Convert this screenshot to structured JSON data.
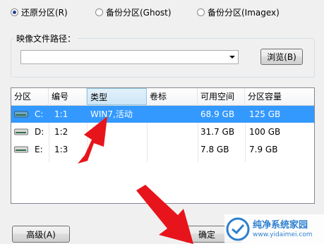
{
  "options": {
    "restore": "还原分区(R)",
    "backup_ghost": "备份分区(Ghost)",
    "backup_imagex": "备份分区(Imagex)"
  },
  "image_path": {
    "label": "映像文件路径：",
    "value": "",
    "browse_label": "浏览(B)"
  },
  "table": {
    "columns": [
      "分区",
      "编号",
      "类型",
      "卷标",
      "可用空间",
      "分区容量"
    ],
    "rows": [
      {
        "drive": "C:",
        "number": "1:1",
        "type": "WIN7,活动",
        "label": "",
        "free": "68.9 GB",
        "size": "125 GB",
        "selected": true
      },
      {
        "drive": "D:",
        "number": "1:2",
        "type": "",
        "label": "",
        "free": "31.7 GB",
        "size": "100 GB",
        "selected": false
      },
      {
        "drive": "E:",
        "number": "1:3",
        "type": "",
        "label": "",
        "free": "7.8 GB",
        "size": "7.9 GB",
        "selected": false
      }
    ]
  },
  "footer": {
    "advanced_label": "高级(A)",
    "ok_label": "确定"
  },
  "watermark": {
    "name": "纯净系统家园",
    "url": "www.yidaimei.com"
  },
  "colors": {
    "selection": "#3399ff",
    "arrow": "#e8141b"
  }
}
